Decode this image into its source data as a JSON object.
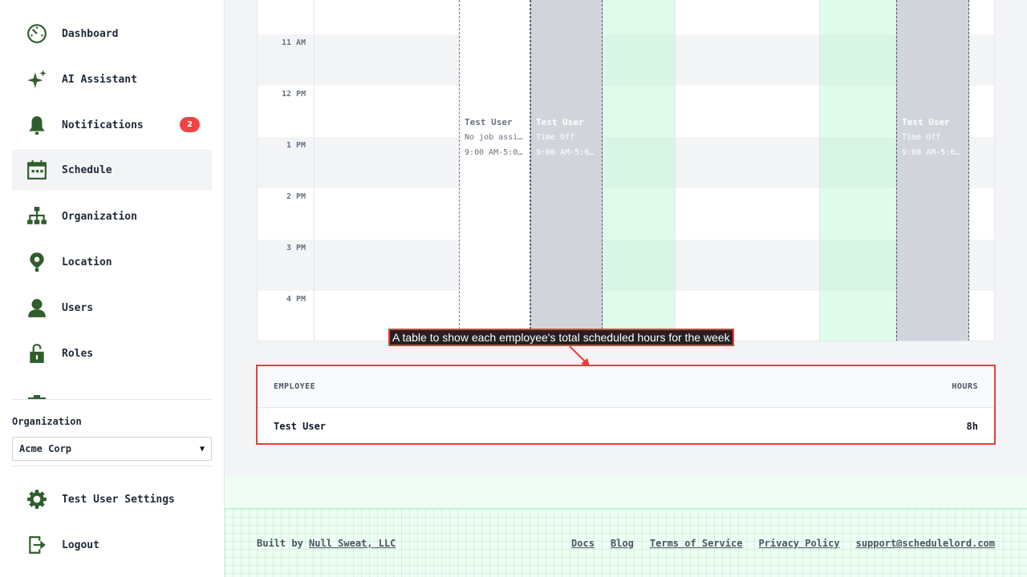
{
  "sidebar": {
    "items": [
      {
        "label": "Dashboard",
        "icon": "dashboard-icon"
      },
      {
        "label": "AI Assistant",
        "icon": "sparkle-icon"
      },
      {
        "label": "Notifications",
        "icon": "bell-icon",
        "badge": "2"
      },
      {
        "label": "Schedule",
        "icon": "calendar-icon",
        "active": true
      },
      {
        "label": "Organization",
        "icon": "org-chart-icon"
      },
      {
        "label": "Location",
        "icon": "map-pin-icon"
      },
      {
        "label": "Users",
        "icon": "user-icon"
      },
      {
        "label": "Roles",
        "icon": "lock-icon"
      }
    ],
    "org_label": "Organization",
    "org_selected": "Acme Corp",
    "settings_label": "Test User Settings",
    "logout_label": "Logout"
  },
  "calendar": {
    "time_labels": [
      "11 AM",
      "12 PM",
      "1 PM",
      "2 PM",
      "3 PM",
      "4 PM"
    ],
    "events": [
      {
        "name": "Test User",
        "detail": "No job assi…",
        "time": "9:00 AM-5:0…",
        "kind": "free"
      },
      {
        "name": "Test User",
        "detail": "Time Off",
        "time": "9:00 AM-5:0…",
        "kind": "off"
      },
      {
        "name": "Test User",
        "detail": "Time Off",
        "time": "9:00 AM-5:0…",
        "kind": "off"
      }
    ]
  },
  "annotation": {
    "text": "A table to show each employee's total scheduled hours for the week"
  },
  "hours_table": {
    "headers": [
      "EMPLOYEE",
      "HOURS"
    ],
    "rows": [
      {
        "employee": "Test User",
        "hours": "8h"
      }
    ]
  },
  "footer": {
    "built_by_prefix": "Built by ",
    "built_by_link": "Null Sweat, LLC",
    "links": [
      "Docs",
      "Blog",
      "Terms of Service",
      "Privacy Policy",
      "support@schedulelord.com"
    ]
  },
  "colors": {
    "brand_green": "#2f5d2b",
    "badge_red": "#ef4444",
    "annotation_red": "#e53e3e"
  }
}
